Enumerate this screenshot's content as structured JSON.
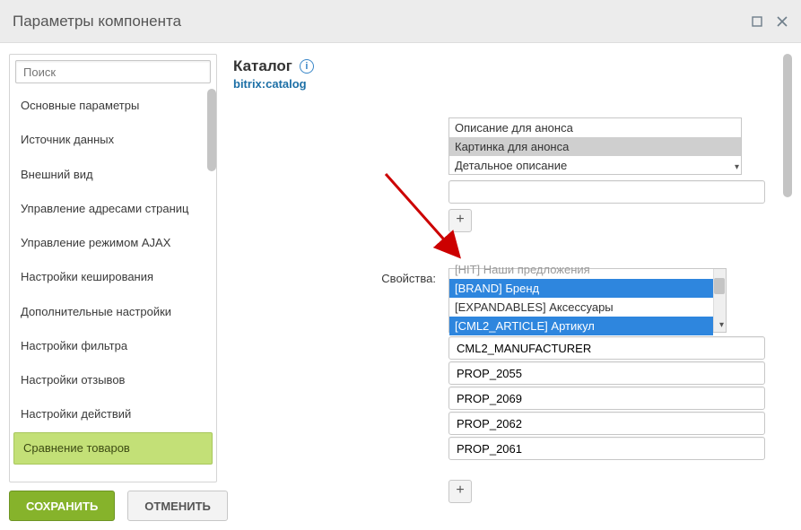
{
  "window": {
    "title": "Параметры компонента"
  },
  "search": {
    "placeholder": "Поиск"
  },
  "sidebar": {
    "items": [
      {
        "label": "Основные параметры"
      },
      {
        "label": "Источник данных"
      },
      {
        "label": "Внешний вид"
      },
      {
        "label": "Управление адресами страниц"
      },
      {
        "label": "Управление режимом AJAX"
      },
      {
        "label": "Настройки кеширования"
      },
      {
        "label": "Дополнительные настройки"
      },
      {
        "label": "Настройки фильтра"
      },
      {
        "label": "Настройки отзывов"
      },
      {
        "label": "Настройки действий"
      },
      {
        "label": "Сравнение товаров",
        "active": true
      }
    ]
  },
  "header": {
    "title": "Каталог",
    "component_id": "bitrix:catalog"
  },
  "upper_list": {
    "options": [
      {
        "label": "Описание для анонса",
        "selected": false
      },
      {
        "label": "Картинка для анонса",
        "selected": true,
        "style": "gray"
      },
      {
        "label": "Детальное описание",
        "selected": false
      }
    ],
    "text_value": ""
  },
  "props_label": "Свойства:",
  "props_list": {
    "options": [
      {
        "label": "[HIT] Наши предложения",
        "selected": false,
        "clipped": true
      },
      {
        "label": "[BRAND] Бренд",
        "selected": true,
        "style": "blue"
      },
      {
        "label": "[EXPANDABLES] Аксессуары",
        "selected": false
      },
      {
        "label": "[CML2_ARTICLE] Артикул",
        "selected": true,
        "style": "blue"
      }
    ]
  },
  "prop_inputs": [
    "CML2_MANUFACTURER",
    "PROP_2055",
    "PROP_2069",
    "PROP_2062",
    "PROP_2061"
  ],
  "buttons": {
    "save": "СОХРАНИТЬ",
    "cancel": "ОТМЕНИТЬ",
    "add": "+"
  }
}
